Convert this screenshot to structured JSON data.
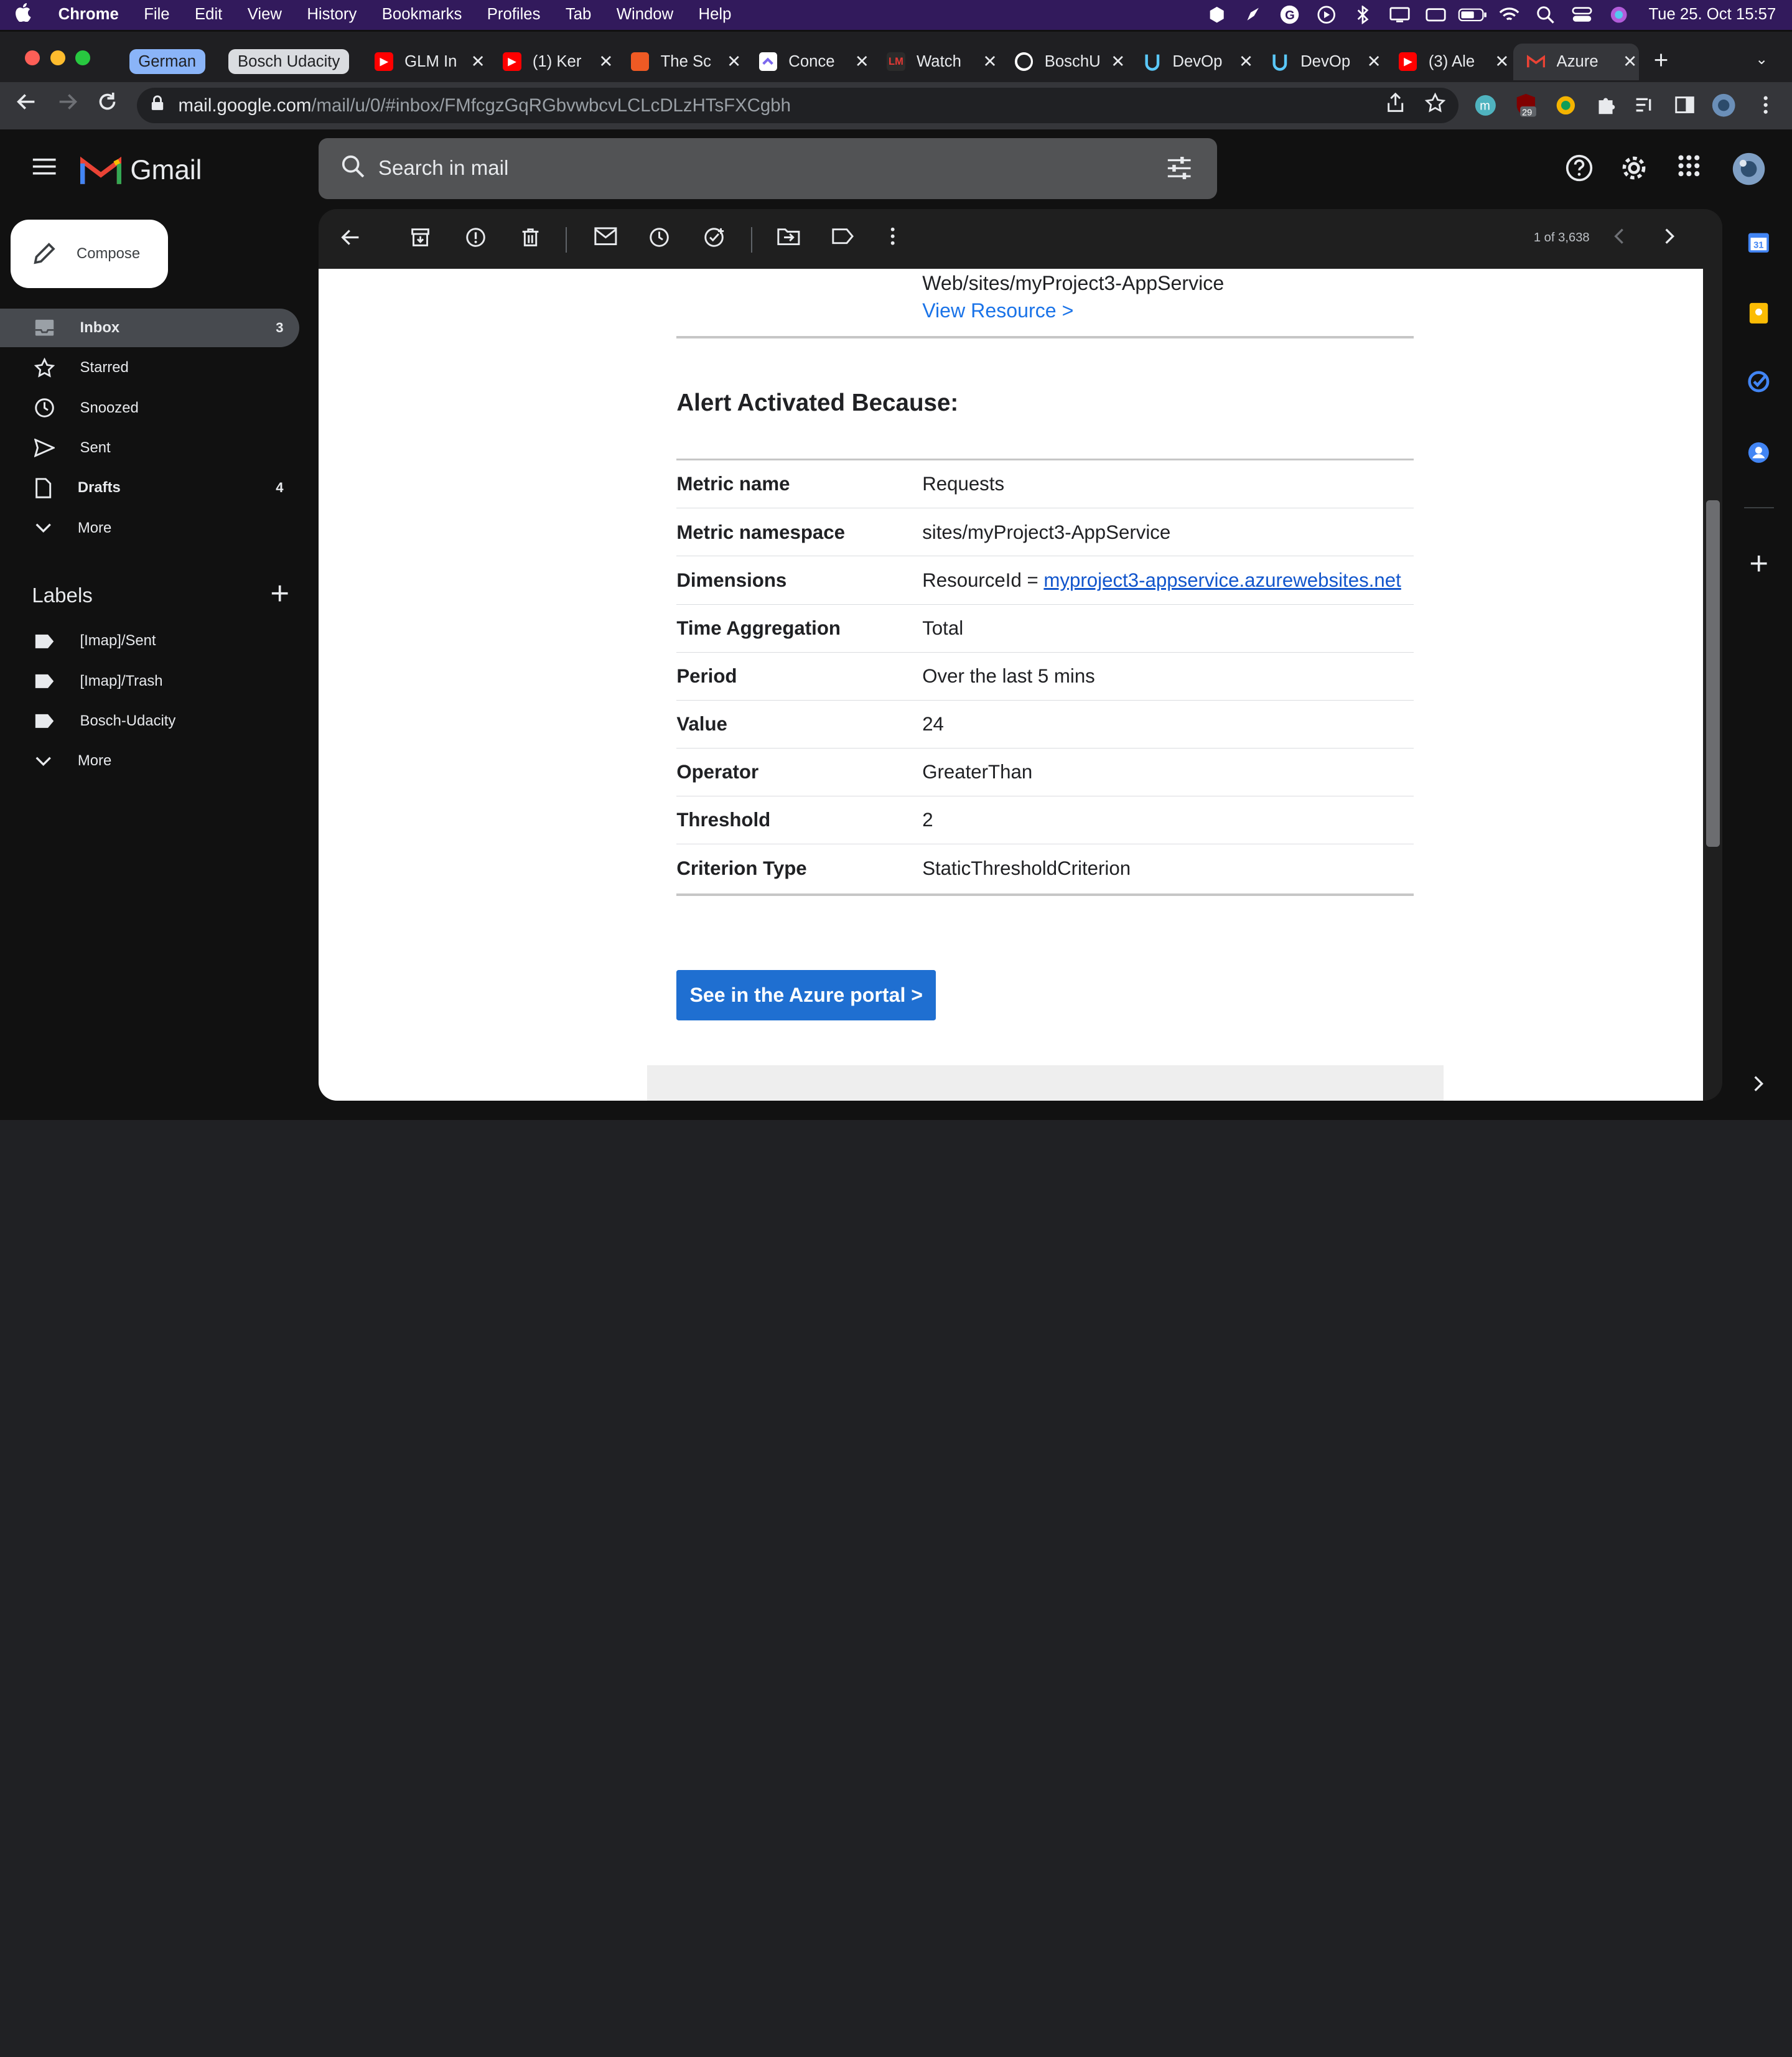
{
  "menubar": {
    "app": "Chrome",
    "items": [
      "File",
      "Edit",
      "View",
      "History",
      "Bookmarks",
      "Profiles",
      "Tab",
      "Window",
      "Help"
    ],
    "clock": "Tue 25. Oct  15:57"
  },
  "tabs": {
    "group1": "German",
    "group2": "Bosch Udacity",
    "items": [
      {
        "title": "GLM In",
        "icon": "youtube-icon"
      },
      {
        "title": "(1) Ker",
        "icon": "youtube-icon"
      },
      {
        "title": "The Sc",
        "icon": "page-icon"
      },
      {
        "title": "Conce",
        "icon": "clickup-icon"
      },
      {
        "title": "Watch",
        "icon": "lm-icon"
      },
      {
        "title": "BoschU",
        "icon": "github-icon"
      },
      {
        "title": "DevOp",
        "icon": "udacity-icon"
      },
      {
        "title": "DevOp",
        "icon": "udacity-icon"
      },
      {
        "title": "(3) Ale",
        "icon": "youtube-icon"
      },
      {
        "title": "Azure",
        "icon": "gmail-icon"
      }
    ]
  },
  "address": {
    "host": "mail.google.com",
    "path": "/mail/u/0/#inbox/FMfcgzGqRGbvwbcvLCLcDLzHTsFXCgbh"
  },
  "extensions": {
    "badge": "29"
  },
  "gmail": {
    "brand": "Gmail",
    "search_placeholder": "Search in mail",
    "compose": "Compose",
    "nav": [
      {
        "label": "Inbox",
        "count": "3"
      },
      {
        "label": "Starred",
        "count": ""
      },
      {
        "label": "Snoozed",
        "count": ""
      },
      {
        "label": "Sent",
        "count": ""
      },
      {
        "label": "Drafts",
        "count": "4"
      },
      {
        "label": "More",
        "count": ""
      }
    ],
    "labels_title": "Labels",
    "labels": [
      "[Imap]/Sent",
      "[Imap]/Trash",
      "Bosch-Udacity",
      "More"
    ],
    "pager": "1 of 3,638"
  },
  "email": {
    "resource_path": "Web/sites/myProject3-AppService",
    "view_resource": "View Resource >",
    "alert_title": "Alert Activated Because:",
    "rows": [
      {
        "key": "Metric name",
        "value": "Requests"
      },
      {
        "key": "Metric namespace",
        "value": "sites/myProject3-AppService"
      },
      {
        "key": "Dimensions",
        "value": "ResourceId = ",
        "link": "myproject3-appservice.azurewebsites.net"
      },
      {
        "key": "Time Aggregation",
        "value": "Total"
      },
      {
        "key": "Period",
        "value": "Over the last 5 mins"
      },
      {
        "key": "Value",
        "value": "24"
      },
      {
        "key": "Operator",
        "value": "GreaterThan"
      },
      {
        "key": "Threshold",
        "value": "2"
      },
      {
        "key": "Criterion Type",
        "value": "StaticThresholdCriterion"
      }
    ],
    "cta": "See in the Azure portal >"
  }
}
